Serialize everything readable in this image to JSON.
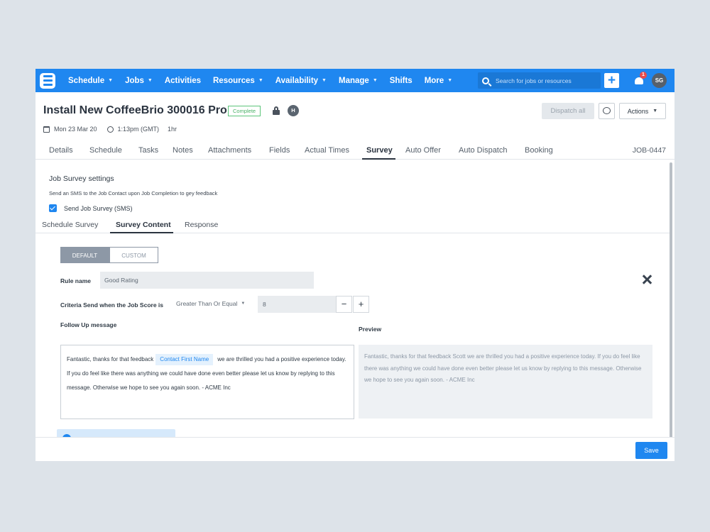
{
  "nav": {
    "items": [
      {
        "label": "Schedule",
        "caret": true
      },
      {
        "label": "Jobs",
        "caret": true
      },
      {
        "label": "Activities",
        "caret": false
      },
      {
        "label": "Resources",
        "caret": true
      },
      {
        "label": "Availability",
        "caret": true
      },
      {
        "label": "Manage",
        "caret": true
      },
      {
        "label": "Shifts",
        "caret": false
      },
      {
        "label": "More",
        "caret": true
      }
    ],
    "search_placeholder": "Search for jobs or resources",
    "notification_count": "1",
    "user_initials": "SG"
  },
  "job": {
    "title": "Install New CoffeeBrio 300016 Pro",
    "status": "Complete",
    "badge": "H",
    "date": "Mon 23 Mar 20",
    "time": "1:13pm (GMT)",
    "duration": "1hr",
    "id": "JOB-0447"
  },
  "header_buttons": {
    "dispatch": "Dispatch all",
    "actions": "Actions"
  },
  "tabs": [
    "Details",
    "Schedule",
    "Tasks",
    "Notes",
    "Attachments",
    "Fields",
    "Actual Times",
    "Survey",
    "Auto Offer",
    "Auto Dispatch",
    "Booking"
  ],
  "active_tab": "Survey",
  "survey": {
    "heading": "Job Survey settings",
    "description": "Send an SMS to the Job Contact upon Job Completion to gey feedback",
    "send_label": "Send Job Survey (SMS)",
    "send_checked": true,
    "subtabs": [
      "Schedule Survey",
      "Survey Content",
      "Response"
    ],
    "active_subtab": "Survey Content",
    "toggle": {
      "default": "DEFAULT",
      "custom": "CUSTOM",
      "selected": "DEFAULT"
    },
    "rule_name_label": "Rule name",
    "rule_name_value": "Good Rating",
    "criteria_label": "Criteria Send when the Job Score is",
    "criteria_operator": "Greater Than Or Equal",
    "criteria_value": "8",
    "followup_label": "Follow Up message",
    "preview_label": "Preview",
    "message_before": "Fantastic, thanks for that feedback",
    "message_chip": "Contact First Name",
    "message_after": "we are thrilled you had a positive experience today. If you do feel like there was anything we could have done even better please let us know by replying to this message. Otherwise we hope to see you again soon. - ACME Inc",
    "preview_text": "Fantastic, thanks for that feedback Scott we are thrilled you had a positive experience today. If you do feel like there was anything we could have done even better please let us know by replying to this message. Otherwise we hope to see you again soon. - ACME Inc"
  },
  "footer": {
    "save": "Save"
  },
  "colors": {
    "brand": "#1f87f0",
    "status_complete": "#49b166",
    "toggle_selected": "#8d98a6"
  }
}
